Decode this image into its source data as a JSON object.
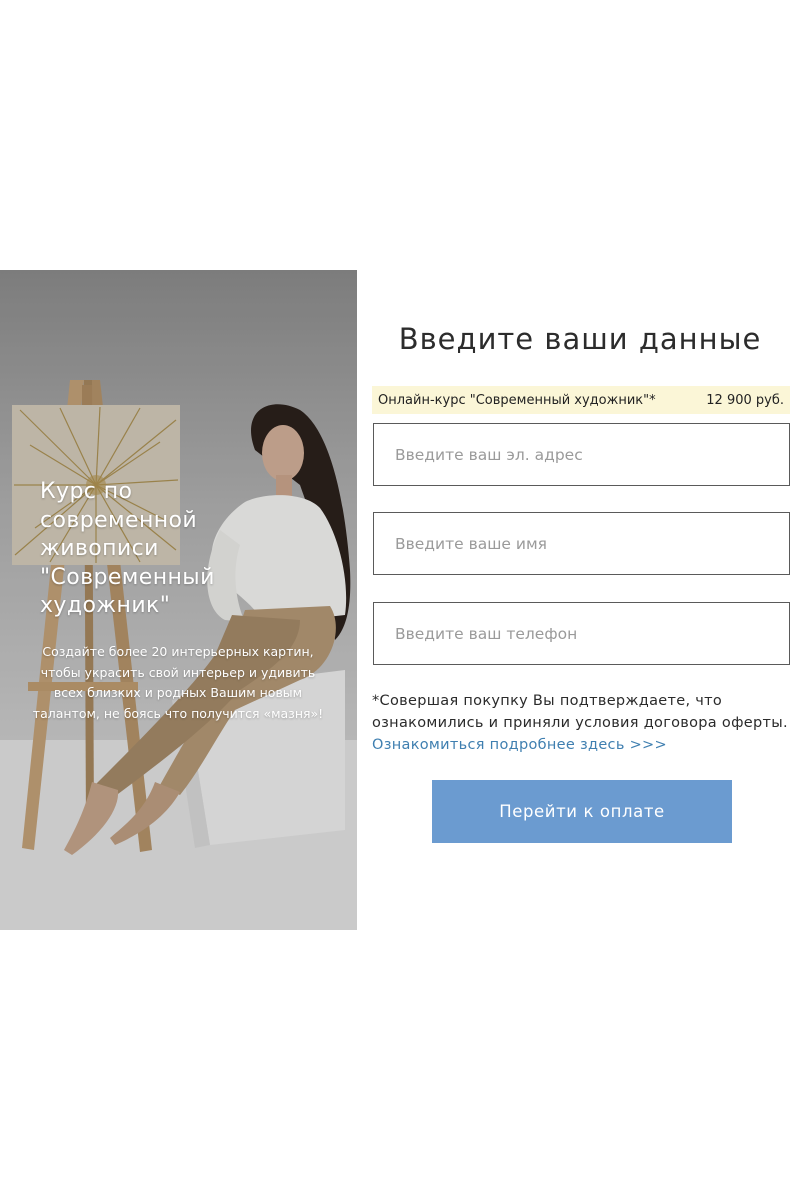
{
  "hero": {
    "title_lines": [
      "Курс по",
      "современной",
      "живописи",
      "\"Современный",
      "художник\""
    ],
    "description": "Создайте более 20 интерьерных картин, чтобы украсить свой интерьер и удивить всех близких и родных Вашим новым талантом, не боясь что получится «мазня»!"
  },
  "form": {
    "title": "Введите ваши данные",
    "product_name": "Онлайн-курс \"Современный художник\"*",
    "product_price": "12 900 руб.",
    "email_placeholder": "Введите ваш эл. адрес",
    "name_placeholder": "Введите ваше имя",
    "phone_placeholder": "Введите ваш телефон",
    "terms_text": "*Совершая покупку Вы подтверждаете, что ознакомились и приняли условия договора оферты.",
    "terms_link": "Ознакомиться подробнее здесь >>>",
    "submit_label": "Перейти к оплате"
  },
  "colors": {
    "accent_button": "#6b9bd0",
    "product_highlight": "#fbf6d7",
    "link": "#3f7fb0"
  }
}
